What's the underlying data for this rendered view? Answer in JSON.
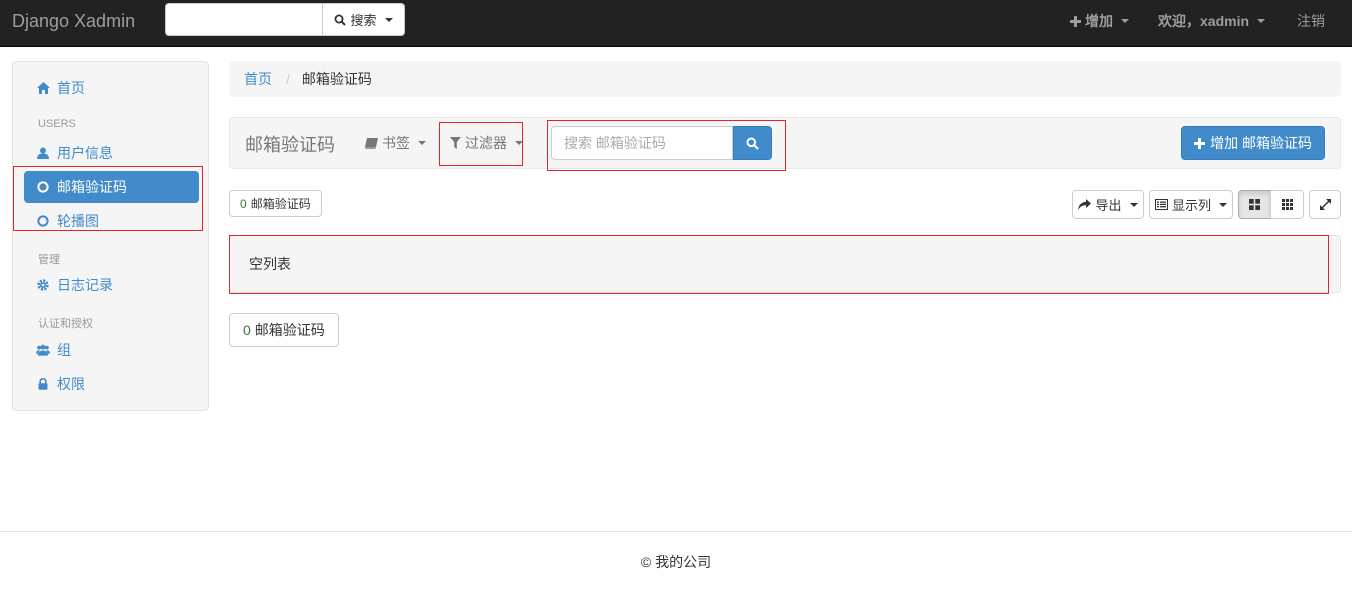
{
  "navbar": {
    "brand": "Django Xadmin",
    "search_value": "",
    "search_button": "搜索",
    "add_label": "增加",
    "welcome_label": "欢迎，xadmin",
    "logout_label": "注销"
  },
  "sidebar": {
    "home": "首页",
    "sections": [
      {
        "heading": "USERS",
        "items": [
          "用户信息",
          "邮箱验证码",
          "轮播图"
        ]
      },
      {
        "heading": "管理",
        "items": [
          "日志记录"
        ]
      },
      {
        "heading": "认证和授权",
        "items": [
          "组",
          "权限"
        ]
      }
    ],
    "active_item": "邮箱验证码"
  },
  "breadcrumb": {
    "home": "首页",
    "separator": "/",
    "current": "邮箱验证码"
  },
  "toolbar": {
    "title": "邮箱验证码",
    "bookmarks_label": "书签",
    "filter_label": "过滤器",
    "search_placeholder": "搜索 邮箱验证码",
    "add_button": "增加 邮箱验证码"
  },
  "result_top": {
    "count": "0",
    "label": "邮箱验证码"
  },
  "actions": {
    "export_label": "导出",
    "columns_label": "显示列"
  },
  "empty_list": "空列表",
  "result_bottom": {
    "count": "0",
    "label": "邮箱验证码"
  },
  "footer": "© 我的公司",
  "colors": {
    "navbar_bg": "#222222",
    "primary": "#428bca",
    "highlight_border": "#e0252b",
    "count_green": "#3c763d"
  },
  "view_mode": "grid-large"
}
